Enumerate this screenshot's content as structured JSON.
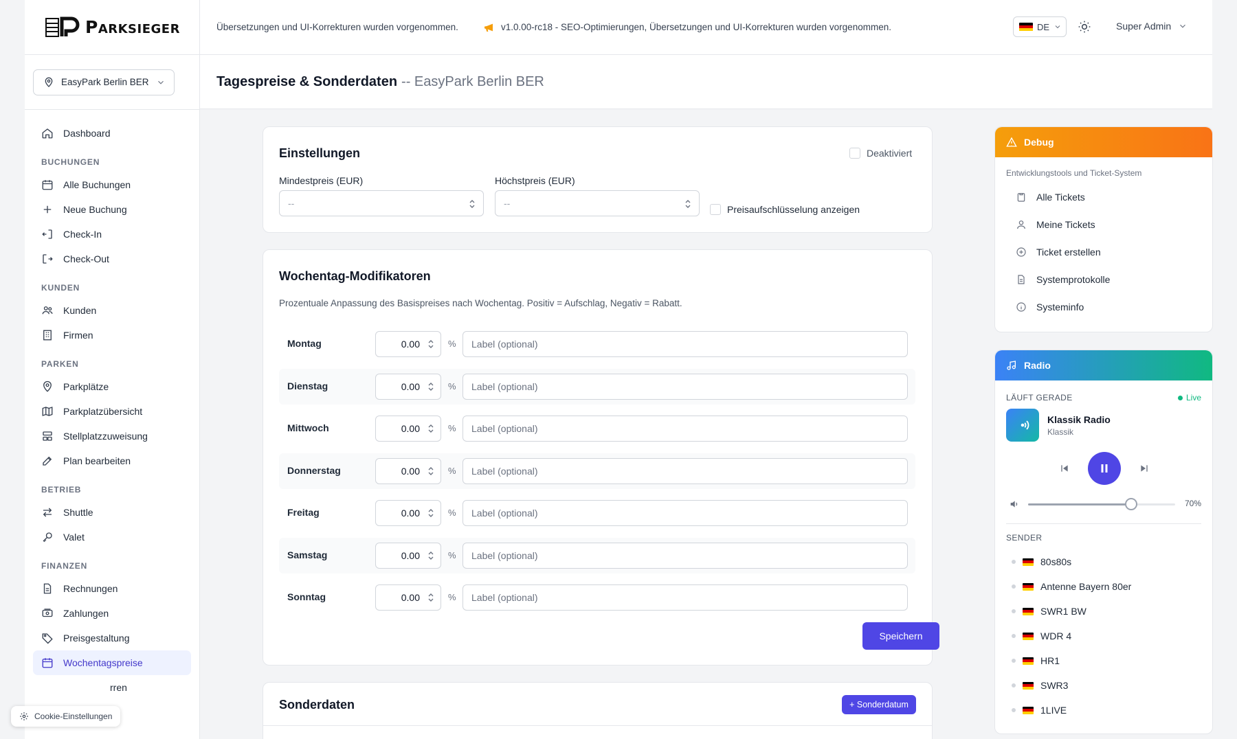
{
  "brand": {
    "name": "Parksieger"
  },
  "location": {
    "selected": "EasyPark Berlin BER"
  },
  "sidebar": {
    "dashboard": "Dashboard",
    "sections": {
      "bookings": "BUCHUNGEN",
      "customers": "KUNDEN",
      "parking": "PARKEN",
      "operations": "BETRIEB",
      "finance": "FINANZEN"
    },
    "items": {
      "all_bookings": "Alle Buchungen",
      "new_booking": "Neue Buchung",
      "check_in": "Check-In",
      "check_out": "Check-Out",
      "customers": "Kunden",
      "companies": "Firmen",
      "parking_lots": "Parkplätze",
      "lot_overview": "Parkplatzübersicht",
      "spot_assignment": "Stellplatzzuweisung",
      "edit_plan": "Plan bearbeiten",
      "shuttle": "Shuttle",
      "valet": "Valet",
      "invoices": "Rechnungen",
      "payments": "Zahlungen",
      "pricing": "Preisgestaltung",
      "weekday_prices": "Wochentagspreise",
      "partial_hidden": "rren"
    }
  },
  "header": {
    "message": "Übersetzungen und UI-Korrekturen wurden vorgenommen.",
    "release": "v1.0.00-rc18 - SEO-Optimierungen, Übersetzungen und UI-Korrekturen wurden vorgenommen.",
    "language": "DE",
    "user": "Super Admin"
  },
  "page": {
    "title": "Tagespreise & Sonderdaten",
    "subtitle": "-- EasyPark Berlin BER"
  },
  "settings": {
    "title": "Einstellungen",
    "deactivated_label": "Deaktiviert",
    "min_price_label": "Mindestpreis (EUR)",
    "min_price_placeholder": "--",
    "max_price_label": "Höchstpreis (EUR)",
    "max_price_placeholder": "--",
    "breakdown_label": "Preisaufschlüsselung anzeigen"
  },
  "weekday": {
    "title": "Wochentag-Modifikatoren",
    "description": "Prozentuale Anpassung des Basispreises nach Wochentag. Positiv = Aufschlag, Negativ = Rabatt.",
    "unit": "%",
    "label_placeholder": "Label (optional)",
    "days": [
      {
        "name": "Montag",
        "value": "0.00"
      },
      {
        "name": "Dienstag",
        "value": "0.00"
      },
      {
        "name": "Mittwoch",
        "value": "0.00"
      },
      {
        "name": "Donnerstag",
        "value": "0.00"
      },
      {
        "name": "Freitag",
        "value": "0.00"
      },
      {
        "name": "Samstag",
        "value": "0.00"
      },
      {
        "name": "Sonntag",
        "value": "0.00"
      }
    ],
    "save_label": "Speichern"
  },
  "special_dates": {
    "title": "Sonderdaten",
    "add_label": "+ Sonderdatum"
  },
  "debug": {
    "title": "Debug",
    "subtitle": "Entwicklungstools und Ticket-System",
    "items": {
      "all_tickets": "Alle Tickets",
      "my_tickets": "Meine Tickets",
      "create_ticket": "Ticket erstellen",
      "system_logs": "Systemprotokolle",
      "system_info": "Systeminfo"
    }
  },
  "radio": {
    "title": "Radio",
    "now_playing_label": "LÄUFT GERADE",
    "live_label": "Live",
    "station_name": "Klassik Radio",
    "station_genre": "Klassik",
    "volume": 0.7,
    "volume_label": "70%",
    "stations_label": "SENDER",
    "stations": [
      "80s80s",
      "Antenne Bayern 80er",
      "SWR1 BW",
      "WDR 4",
      "HR1",
      "SWR3",
      "1LIVE"
    ]
  },
  "cookie": {
    "label": "Cookie-Einstellungen"
  },
  "colors": {
    "primary": "#4f46e5",
    "debug_gradient_start": "#f59e0b",
    "debug_gradient_end": "#f97316",
    "radio_gradient_start": "#3b82f6",
    "radio_gradient_end": "#10b981",
    "live": "#10b981"
  }
}
